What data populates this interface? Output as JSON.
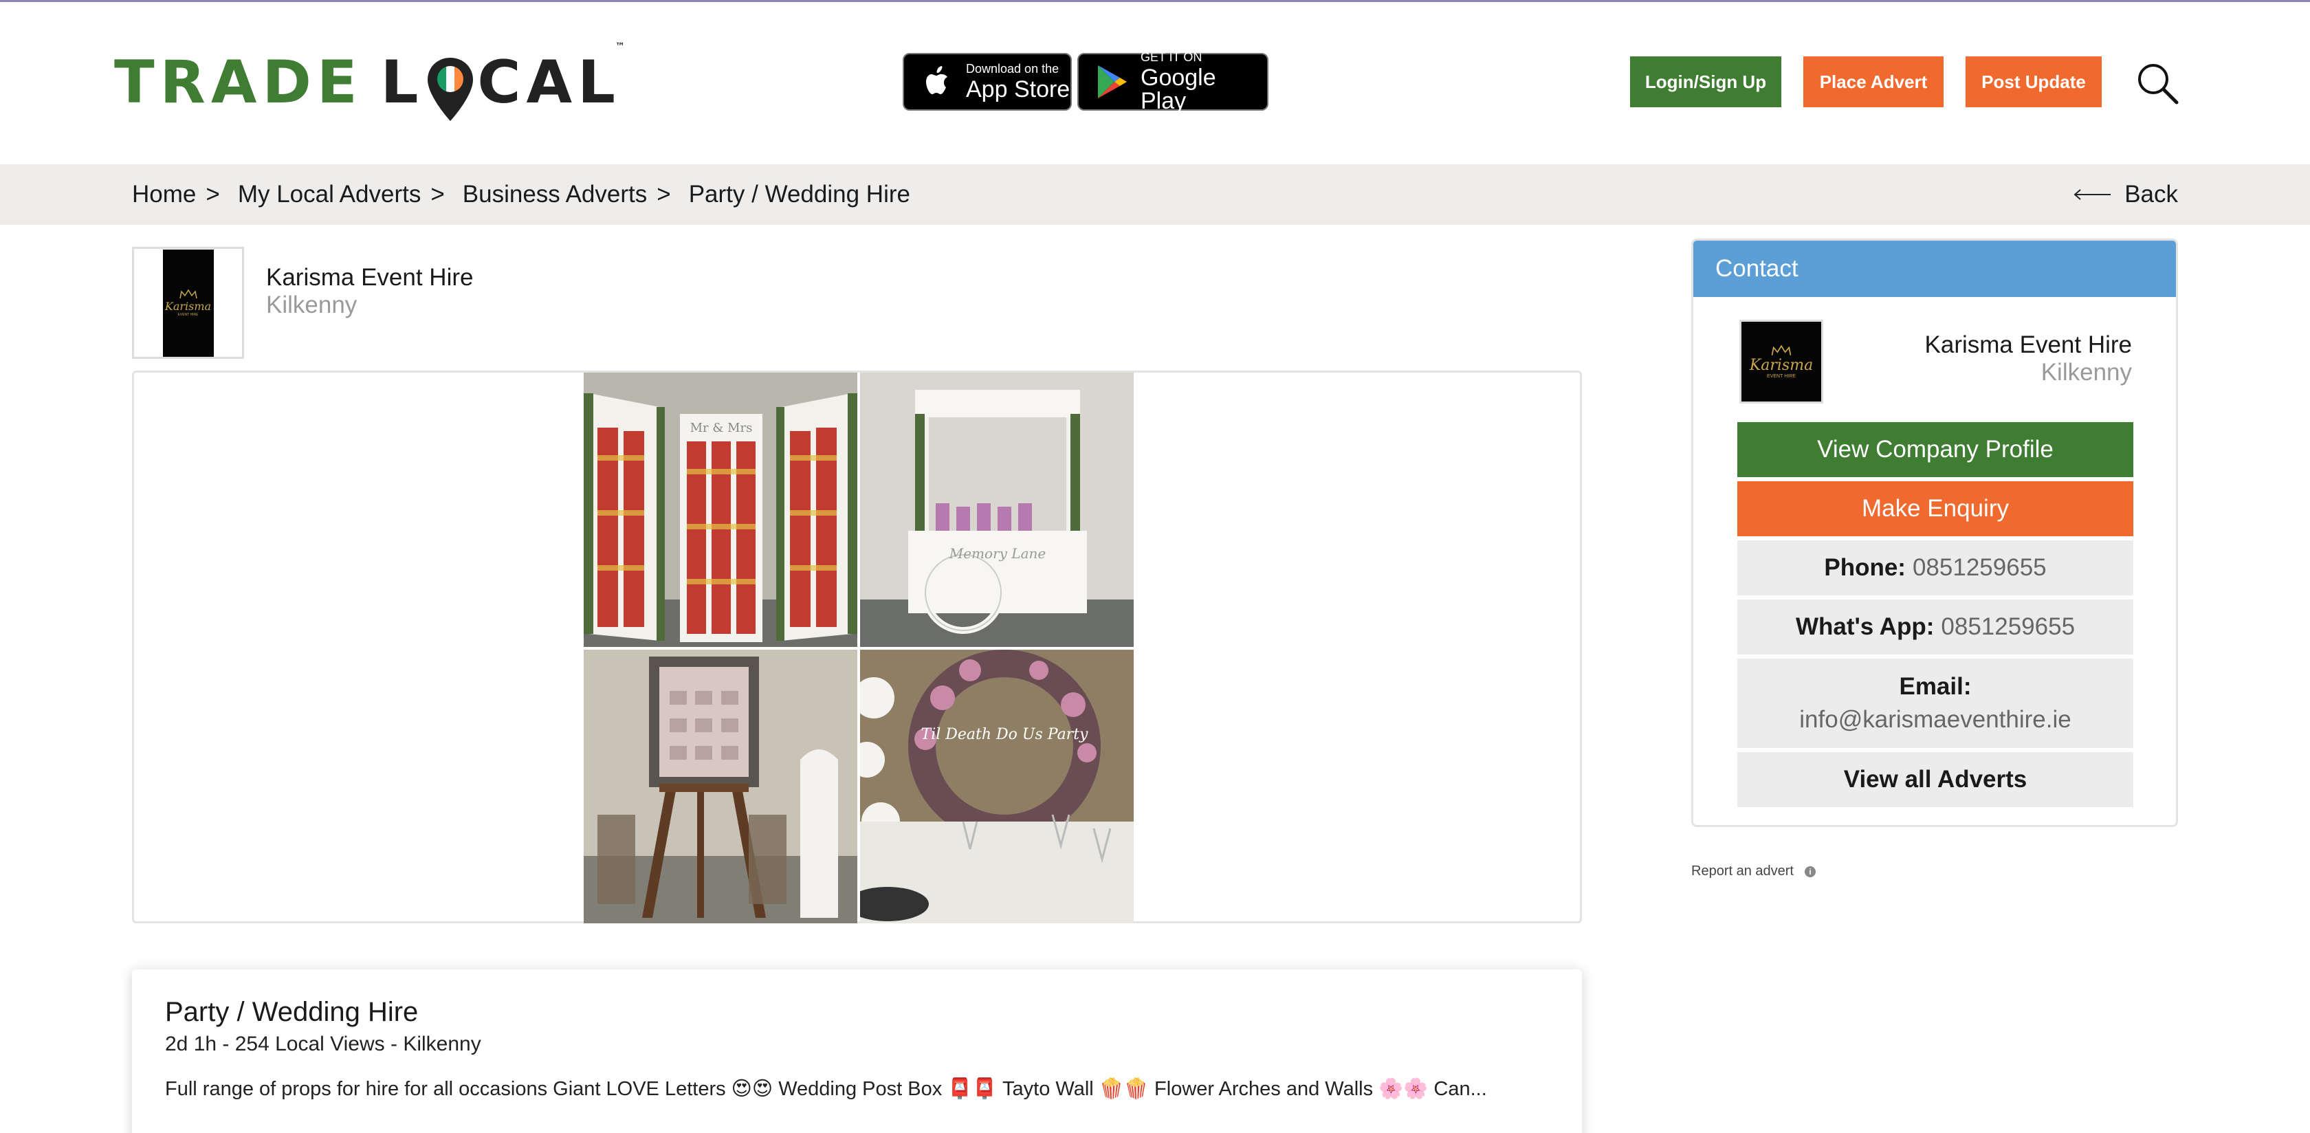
{
  "header": {
    "logo": {
      "word1": "TRADE",
      "word2a": "L",
      "word2b": "CAL",
      "tm": "™"
    },
    "app_store": {
      "small": "Download on the",
      "big": "App Store",
      "icon": "apple-icon"
    },
    "google_play": {
      "small": "GET IT ON",
      "big": "Google Play",
      "icon": "google-play-icon"
    },
    "login_label": "Login/Sign Up",
    "place_advert_label": "Place Advert",
    "post_update_label": "Post Update",
    "search_icon": "search-icon",
    "colors": {
      "green": "#3f7d32",
      "orange": "#f06a30",
      "blue": "#5b9fd6"
    }
  },
  "breadcrumb": {
    "items": [
      "Home",
      "My Local Adverts",
      "Business Adverts",
      "Party / Wedding Hire"
    ],
    "separator": ">",
    "back_label": "Back"
  },
  "business": {
    "name": "Karisma Event Hire",
    "location": "Kilkenny",
    "logo_text": "Karisma",
    "logo_sub": "EVENT HIRE"
  },
  "advert": {
    "title": "Party / Wedding Hire",
    "meta": "2d 1h - 254 Local Views - Kilkenny",
    "description": "Full range of props for hire for all occasions Giant LOVE Letters 😍😍 Wedding Post Box 📮📮 Tayto Wall 🍿🍿 Flower Arches and Walls 🌸🌸 Can..."
  },
  "gallery": {
    "photo2_text": "Memory Lane",
    "photo4_text": "Til Death Do Us Party",
    "wall_banner": "Mr & Mrs"
  },
  "contact": {
    "header": "Contact",
    "name": "Karisma Event Hire",
    "location": "Kilkenny",
    "view_profile_label": "View Company Profile",
    "make_enquiry_label": "Make Enquiry",
    "phone_label": "Phone:",
    "phone_value": "0851259655",
    "whatsapp_label": "What's App:",
    "whatsapp_value": "0851259655",
    "email_label": "Email:",
    "email_value": "info@karismaeventhire.ie",
    "view_all_label": "View all Adverts"
  },
  "report": {
    "label": "Report an advert",
    "icon_glyph": "i"
  }
}
